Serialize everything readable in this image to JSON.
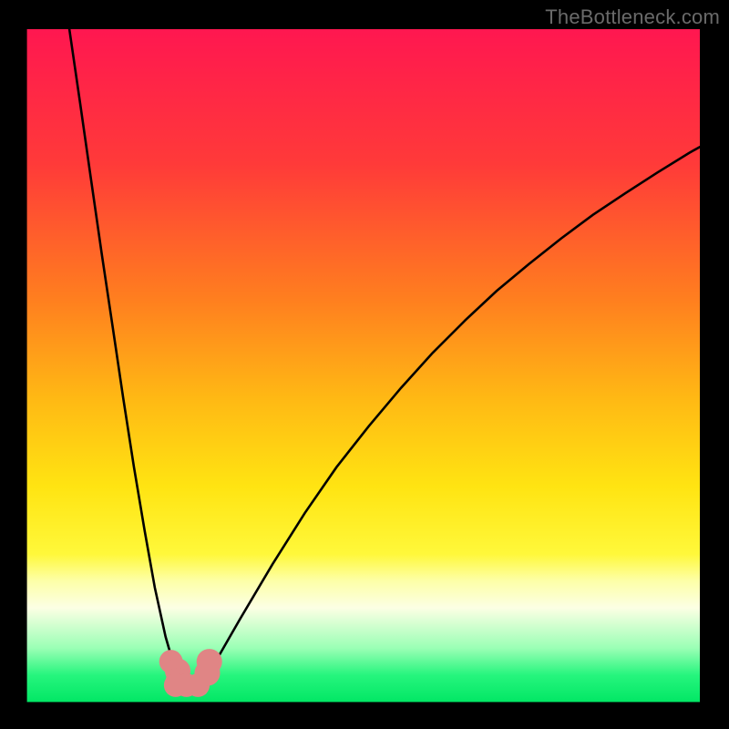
{
  "watermark": "TheBottleneck.com",
  "chart_data": {
    "type": "line",
    "title": "",
    "xlabel": "",
    "ylabel": "",
    "xlim": [
      0,
      1
    ],
    "ylim": [
      0,
      1
    ],
    "gradient_stops": [
      {
        "offset": 0.0,
        "color": "#ff1750"
      },
      {
        "offset": 0.2,
        "color": "#ff3a39"
      },
      {
        "offset": 0.4,
        "color": "#ff7e1f"
      },
      {
        "offset": 0.55,
        "color": "#ffb914"
      },
      {
        "offset": 0.68,
        "color": "#ffe412"
      },
      {
        "offset": 0.78,
        "color": "#fff83a"
      },
      {
        "offset": 0.82,
        "color": "#fdffa8"
      },
      {
        "offset": 0.86,
        "color": "#fcffe4"
      },
      {
        "offset": 0.92,
        "color": "#9affb5"
      },
      {
        "offset": 0.96,
        "color": "#26f57d"
      },
      {
        "offset": 1.0,
        "color": "#02e765"
      }
    ],
    "series": [
      {
        "name": "left-curve",
        "x": [
          0.063,
          0.079,
          0.095,
          0.111,
          0.127,
          0.143,
          0.159,
          0.175,
          0.19,
          0.206,
          0.221,
          0.23
        ],
        "y": [
          0.0,
          0.11,
          0.222,
          0.333,
          0.44,
          0.548,
          0.651,
          0.746,
          0.83,
          0.903,
          0.955,
          0.973
        ]
      },
      {
        "name": "right-curve",
        "x": [
          0.262,
          0.286,
          0.317,
          0.365,
          0.413,
          0.46,
          0.508,
          0.556,
          0.603,
          0.651,
          0.698,
          0.746,
          0.794,
          0.841,
          0.889,
          0.937,
          0.984,
          1.0
        ],
        "y": [
          0.968,
          0.93,
          0.876,
          0.795,
          0.719,
          0.651,
          0.59,
          0.533,
          0.481,
          0.433,
          0.389,
          0.349,
          0.311,
          0.276,
          0.244,
          0.213,
          0.184,
          0.175
        ]
      }
    ],
    "markers": [
      {
        "cx": 0.214,
        "cy": 0.94,
        "r": 0.0175
      },
      {
        "cx": 0.224,
        "cy": 0.954,
        "r": 0.019
      },
      {
        "cx": 0.224,
        "cy": 0.967,
        "r": 0.0175
      },
      {
        "cx": 0.221,
        "cy": 0.975,
        "r": 0.0175
      },
      {
        "cx": 0.237,
        "cy": 0.975,
        "r": 0.0175
      },
      {
        "cx": 0.254,
        "cy": 0.975,
        "r": 0.0175
      },
      {
        "cx": 0.268,
        "cy": 0.957,
        "r": 0.019
      },
      {
        "cx": 0.271,
        "cy": 0.94,
        "r": 0.019
      }
    ],
    "marker_color": "#e08585",
    "background_color": "#000000",
    "field_inset": {
      "top": 0.04,
      "right": 0.04,
      "bottom": 0.037,
      "left": 0.037
    }
  }
}
